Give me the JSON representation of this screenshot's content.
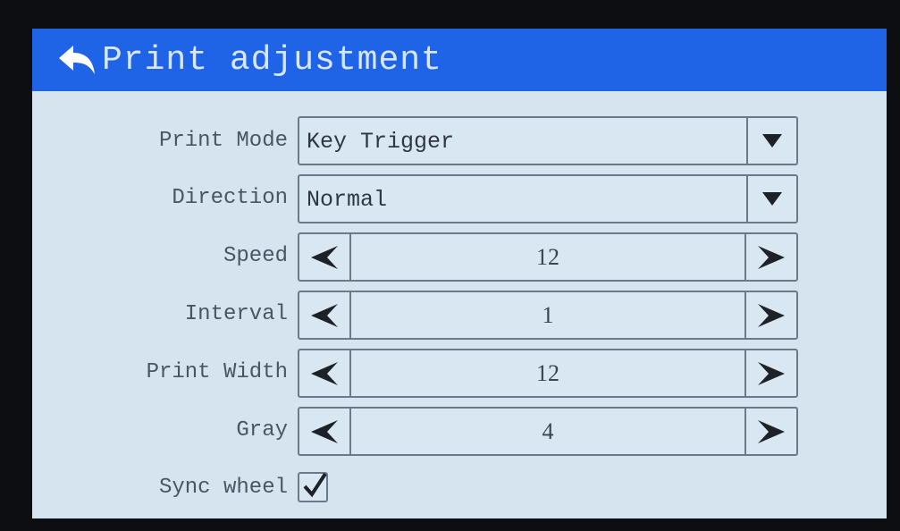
{
  "header": {
    "title": "Print adjustment",
    "back_icon": "back-arrow-icon"
  },
  "form": {
    "print_mode": {
      "label": "Print Mode",
      "value": "Key Trigger"
    },
    "direction": {
      "label": "Direction",
      "value": "Normal"
    },
    "speed": {
      "label": "Speed",
      "value": "12"
    },
    "interval": {
      "label": "Interval",
      "value": "1"
    },
    "print_width": {
      "label": "Print Width",
      "value": "12"
    },
    "gray": {
      "label": "Gray",
      "value": "4"
    },
    "sync_wheel": {
      "label": "Sync wheel",
      "checked": true
    }
  },
  "colors": {
    "header": "#1f63e6",
    "background": "#d6e4f0",
    "text": "#4a5563"
  }
}
